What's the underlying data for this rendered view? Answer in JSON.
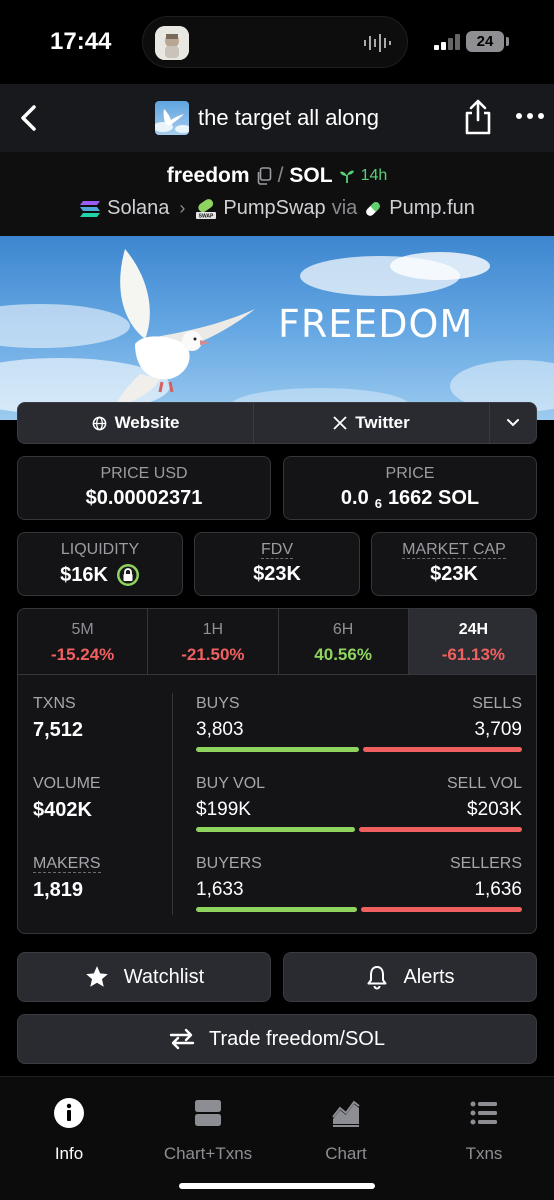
{
  "status": {
    "time": "17:44",
    "battery": "24"
  },
  "header": {
    "title": "the target all along"
  },
  "pair": {
    "base": "freedom",
    "separator": "/",
    "quote": "SOL",
    "age": "14h",
    "chain": "Solana",
    "dex": "PumpSwap",
    "via_label": "via",
    "launchpad": "Pump.fun"
  },
  "banner": {
    "text": "FREEDOM"
  },
  "links": {
    "website": "Website",
    "twitter": "Twitter"
  },
  "prices": {
    "usd_label": "PRICE USD",
    "usd_value": "$0.00002371",
    "native_label": "PRICE",
    "native_prefix": "0.0",
    "native_zeros": "6",
    "native_digits": "1662 SOL"
  },
  "metrics": {
    "liquidity_label": "LIQUIDITY",
    "liquidity_value": "$16K",
    "fdv_label": "FDV",
    "fdv_value": "$23K",
    "mcap_label": "MARKET CAP",
    "mcap_value": "$23K"
  },
  "timeframes": [
    {
      "label": "5M",
      "value": "-15.24%"
    },
    {
      "label": "1H",
      "value": "-21.50%"
    },
    {
      "label": "6H",
      "value": "40.56%"
    },
    {
      "label": "24H",
      "value": "-61.13%"
    }
  ],
  "stats": {
    "txns_label": "TXNS",
    "txns_value": "7,512",
    "volume_label": "VOLUME",
    "volume_value": "$402K",
    "makers_label": "MAKERS",
    "makers_value": "1,819",
    "buys_label": "BUYS",
    "buys_value": "3,803",
    "sells_label": "SELLS",
    "sells_value": "3,709",
    "buyvol_label": "BUY VOL",
    "buyvol_value": "$199K",
    "sellvol_label": "SELL VOL",
    "sellvol_value": "$203K",
    "buyers_label": "BUYERS",
    "buyers_value": "1,633",
    "sellers_label": "SELLERS",
    "sellers_value": "1,636",
    "buy_share_txns": 0.506,
    "buy_share_vol": 0.495,
    "buy_share_makers": 0.5
  },
  "actions": {
    "watchlist": "Watchlist",
    "alerts": "Alerts",
    "trade": "Trade freedom/SOL"
  },
  "tabbar": [
    {
      "label": "Info",
      "icon": "info-icon"
    },
    {
      "label": "Chart+Txns",
      "icon": "split-icon"
    },
    {
      "label": "Chart",
      "icon": "area-chart-icon"
    },
    {
      "label": "Txns",
      "icon": "list-icon"
    }
  ],
  "colors": {
    "positive": "#8fd45e",
    "negative": "#f06060",
    "background": "#141417"
  }
}
